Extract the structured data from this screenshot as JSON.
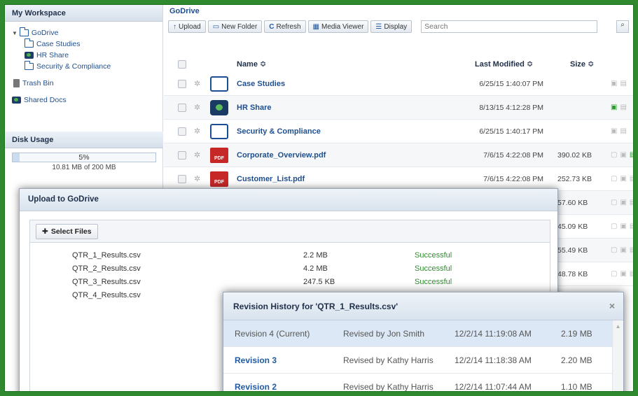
{
  "sidebar": {
    "workspace_title": "My Workspace",
    "tree": {
      "root": "GoDrive",
      "children": [
        "Case Studies",
        "HR Share",
        "Security & Compliance"
      ],
      "trash": "Trash Bin",
      "shared": "Shared Docs"
    },
    "disk": {
      "title": "Disk Usage",
      "percent_label": "5%",
      "percent": 5,
      "detail": "10.81 MB of 200 MB"
    }
  },
  "main": {
    "title": "GoDrive",
    "toolbar": {
      "upload": "Upload",
      "new_folder": "New Folder",
      "refresh": "Refresh",
      "media_viewer": "Media Viewer",
      "display": "Display",
      "search_placeholder": "Search"
    },
    "columns": {
      "name": "Name ≎",
      "modified": "Last Modified ≎",
      "size": "Size ≎"
    },
    "rows": [
      {
        "name": "Case Studies",
        "modified": "6/25/15 1:40:07 PM",
        "size": "",
        "type": "folder"
      },
      {
        "name": "HR Share",
        "modified": "8/13/15 4:12:28 PM",
        "size": "",
        "type": "shared"
      },
      {
        "name": "Security & Compliance",
        "modified": "6/25/15 1:40:17 PM",
        "size": "",
        "type": "folder"
      },
      {
        "name": "Corporate_Overview.pdf",
        "modified": "7/6/15 4:22:08 PM",
        "size": "390.02 KB",
        "type": "pdf"
      },
      {
        "name": "Customer_List.pdf",
        "modified": "7/6/15 4:22:08 PM",
        "size": "252.73 KB",
        "type": "pdf"
      }
    ],
    "hidden_sizes": [
      "57.60 KB",
      "45.09 KB",
      "55.49 KB",
      "48.78 KB"
    ],
    "pdf_badge": "PDF"
  },
  "upload_dialog": {
    "title": "Upload to GoDrive",
    "select_files": "Select Files",
    "files": [
      {
        "name": "QTR_1_Results.csv",
        "size": "2.2 MB",
        "status": "Successful"
      },
      {
        "name": "QTR_2_Results.csv",
        "size": "4.2 MB",
        "status": "Successful"
      },
      {
        "name": "QTR_3_Results.csv",
        "size": "247.5 KB",
        "status": "Successful"
      },
      {
        "name": "QTR_4_Results.csv",
        "size": "",
        "status": ""
      }
    ]
  },
  "revision_dialog": {
    "title": "Revision History for 'QTR_1_Results.csv'",
    "close": "×",
    "revisions": [
      {
        "label": "Revision 4 (Current)",
        "by": "Revised by Jon Smith",
        "date": "12/2/14 11:19:08 AM",
        "size": "2.19 MB"
      },
      {
        "label": "Revision 3",
        "by": "Revised by Kathy Harris",
        "date": "12/2/14 11:18:38 AM",
        "size": "2.20 MB"
      },
      {
        "label": "Revision 2",
        "by": "Revised by Kathy Harris",
        "date": "12/2/14 11:07:44 AM",
        "size": "1.10 MB"
      }
    ]
  },
  "colors": {
    "frame": "#2f8a2f",
    "link": "#1f4f8f",
    "success": "#2e8b2e",
    "pdf": "#c62828"
  }
}
